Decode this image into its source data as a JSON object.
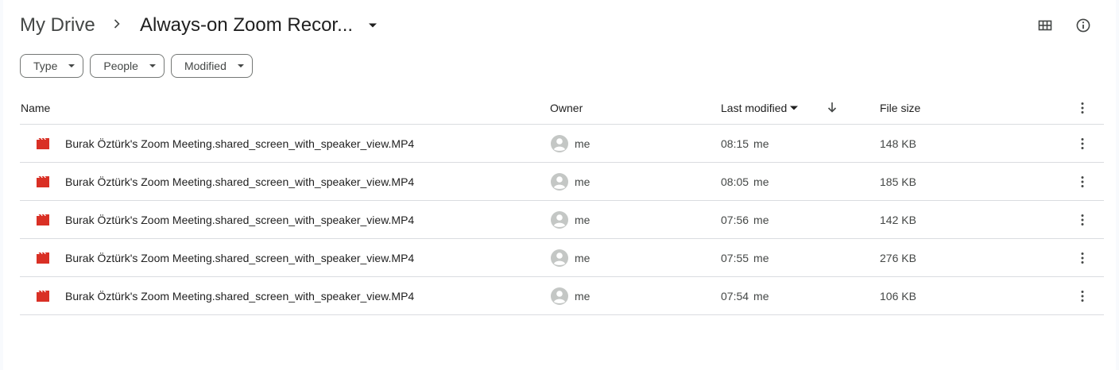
{
  "breadcrumb": {
    "root": "My Drive",
    "current": "Always-on Zoom Recor..."
  },
  "header_icons": [
    "grid-view-icon",
    "info-icon"
  ],
  "filters": [
    {
      "label": "Type"
    },
    {
      "label": "People"
    },
    {
      "label": "Modified"
    }
  ],
  "table": {
    "columns": {
      "name": "Name",
      "owner": "Owner",
      "last_modified": "Last modified",
      "file_size": "File size"
    },
    "rows": [
      {
        "name": "Burak Öztürk's Zoom Meeting.shared_screen_with_speaker_view.MP4",
        "owner": "me",
        "time": "08:15",
        "by": "me",
        "size": "148 KB"
      },
      {
        "name": "Burak Öztürk's Zoom Meeting.shared_screen_with_speaker_view.MP4",
        "owner": "me",
        "time": "08:05",
        "by": "me",
        "size": "185 KB"
      },
      {
        "name": "Burak Öztürk's Zoom Meeting.shared_screen_with_speaker_view.MP4",
        "owner": "me",
        "time": "07:56",
        "by": "me",
        "size": "142 KB"
      },
      {
        "name": "Burak Öztürk's Zoom Meeting.shared_screen_with_speaker_view.MP4",
        "owner": "me",
        "time": "07:55",
        "by": "me",
        "size": "276 KB"
      },
      {
        "name": "Burak Öztürk's Zoom Meeting.shared_screen_with_speaker_view.MP4",
        "owner": "me",
        "time": "07:54",
        "by": "me",
        "size": "106 KB"
      }
    ]
  },
  "colors": {
    "video_icon": "#d93025",
    "divider": "#dadce0",
    "avatar": "#c4c7c5"
  }
}
